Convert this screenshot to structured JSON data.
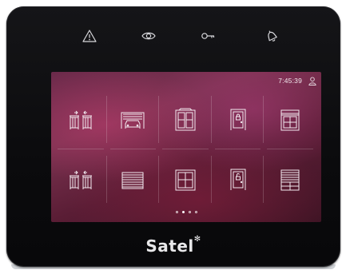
{
  "panel": {
    "top_icons": [
      "alarm-warning-icon",
      "eye-icon",
      "key-icon",
      "bell-icon"
    ],
    "brand": "Satel",
    "brand_mark": "✻"
  },
  "screen": {
    "status_bar": {
      "time": "7:45:39",
      "user_icon": "user-icon"
    },
    "tiles": [
      {
        "icon": "gate-icon"
      },
      {
        "icon": "garage-icon"
      },
      {
        "icon": "window-icon"
      },
      {
        "icon": "door-lock-icon"
      },
      {
        "icon": "window-blind-icon"
      },
      {
        "icon": "gate-icon"
      },
      {
        "icon": "roller-shutter-icon"
      },
      {
        "icon": "window-icon"
      },
      {
        "icon": "door-unlock-icon"
      },
      {
        "icon": "roller-blind-icon"
      }
    ],
    "pager": {
      "pages": 4,
      "active": 2
    }
  }
}
